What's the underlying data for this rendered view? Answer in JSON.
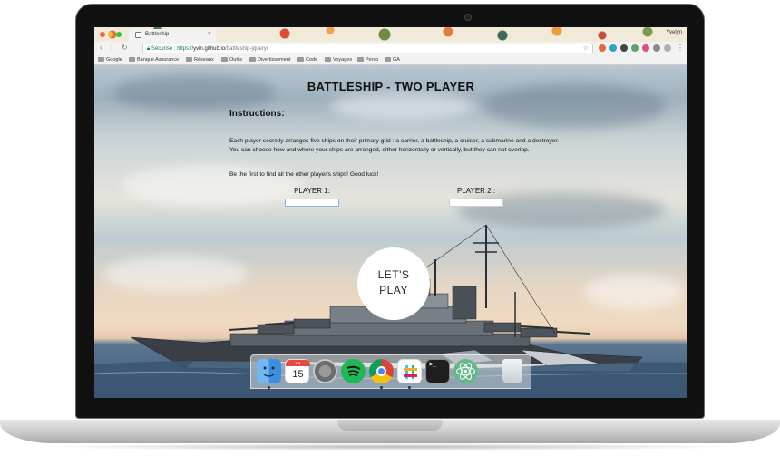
{
  "browser": {
    "tab_title": "Battleship",
    "tab_close": "×",
    "profile_name": "Yvelyn",
    "nav": {
      "back": "‹",
      "forward": "›",
      "reload": "↻"
    },
    "secure_label": "Sécurisé",
    "url_scheme": "https://",
    "url_host": "yvin.github.io",
    "url_path": "/battleship-jquery/",
    "bookmark_star": "☆",
    "bookmarks": [
      "Google",
      "Banque Assurance",
      "Réseaux",
      "Outils",
      "Divertissement",
      "Code",
      "Voyages",
      "Perso",
      "GA"
    ]
  },
  "page": {
    "title": "BATTLESHIP - TWO PLAYER",
    "instructions_heading": "Instructions:",
    "instructions_text": "Each player secretly arranges five ships on their primary grid : a carrier, a battleship, a cruiser, a submarine and a destroyer. You can choose how and where your ships are arranged, either horizontally or vertically, but they can not overlap.",
    "instructions_goal": "Be the first to find all the other player's ships! Good luck!",
    "player1_label": "PLAYER 1:",
    "player2_label": "PLAYER 2 :",
    "player1_value": "",
    "player2_value": "",
    "play_button_line1": "LET'S",
    "play_button_line2": "PLAY"
  },
  "dock": {
    "calendar_day": "15",
    "calendar_month": "JUL",
    "apps": [
      "finder",
      "calendar",
      "system-preferences",
      "spotify",
      "chrome",
      "slack",
      "terminal",
      "atom",
      "trash"
    ]
  },
  "colors": {
    "secure_green": "#0b8043",
    "spotify": "#1db954",
    "chrome_red": "#db4437",
    "finder": "#3b8fe0",
    "atom": "#66b88a"
  }
}
